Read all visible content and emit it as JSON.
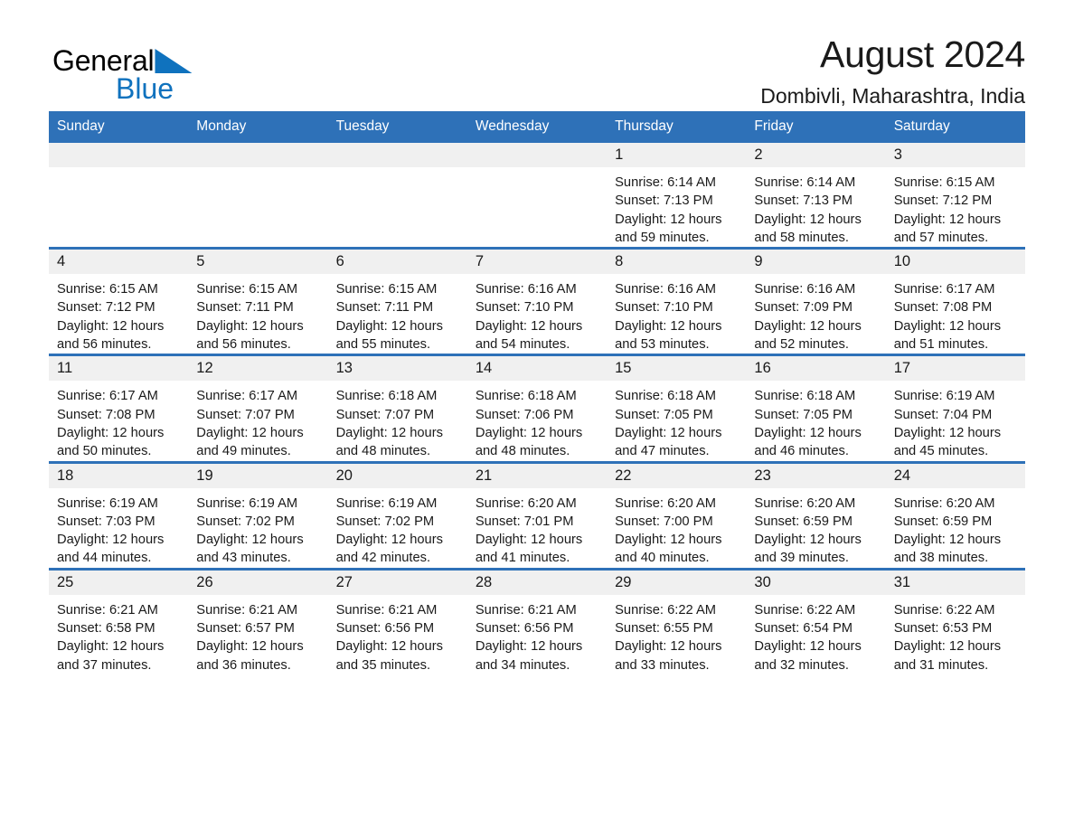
{
  "brand": {
    "name_part1": "General",
    "name_part2": "Blue",
    "triangle_color": "#0F72BE"
  },
  "header": {
    "title": "August 2024",
    "location": "Dombivli, Maharashtra, India"
  },
  "theme": {
    "header_blue": "#2E71B8",
    "daynum_gray": "#F0F0F0",
    "text_color": "#1a1a1a"
  },
  "weekday_headers": [
    "Sunday",
    "Monday",
    "Tuesday",
    "Wednesday",
    "Thursday",
    "Friday",
    "Saturday"
  ],
  "labels": {
    "sunrise_prefix": "Sunrise:",
    "sunset_prefix": "Sunset:",
    "daylight_prefix": "Daylight:"
  },
  "weeks": [
    [
      {
        "day": "",
        "empty": true,
        "line1": "",
        "line2": "",
        "line3": "",
        "line4": ""
      },
      {
        "day": "",
        "empty": true,
        "line1": "",
        "line2": "",
        "line3": "",
        "line4": ""
      },
      {
        "day": "",
        "empty": true,
        "line1": "",
        "line2": "",
        "line3": "",
        "line4": ""
      },
      {
        "day": "",
        "empty": true,
        "line1": "",
        "line2": "",
        "line3": "",
        "line4": ""
      },
      {
        "day": "1",
        "empty": false,
        "line1": "Sunrise: 6:14 AM",
        "line2": "Sunset: 7:13 PM",
        "line3": "Daylight: 12 hours",
        "line4": "and 59 minutes."
      },
      {
        "day": "2",
        "empty": false,
        "line1": "Sunrise: 6:14 AM",
        "line2": "Sunset: 7:13 PM",
        "line3": "Daylight: 12 hours",
        "line4": "and 58 minutes."
      },
      {
        "day": "3",
        "empty": false,
        "line1": "Sunrise: 6:15 AM",
        "line2": "Sunset: 7:12 PM",
        "line3": "Daylight: 12 hours",
        "line4": "and 57 minutes."
      }
    ],
    [
      {
        "day": "4",
        "empty": false,
        "line1": "Sunrise: 6:15 AM",
        "line2": "Sunset: 7:12 PM",
        "line3": "Daylight: 12 hours",
        "line4": "and 56 minutes."
      },
      {
        "day": "5",
        "empty": false,
        "line1": "Sunrise: 6:15 AM",
        "line2": "Sunset: 7:11 PM",
        "line3": "Daylight: 12 hours",
        "line4": "and 56 minutes."
      },
      {
        "day": "6",
        "empty": false,
        "line1": "Sunrise: 6:15 AM",
        "line2": "Sunset: 7:11 PM",
        "line3": "Daylight: 12 hours",
        "line4": "and 55 minutes."
      },
      {
        "day": "7",
        "empty": false,
        "line1": "Sunrise: 6:16 AM",
        "line2": "Sunset: 7:10 PM",
        "line3": "Daylight: 12 hours",
        "line4": "and 54 minutes."
      },
      {
        "day": "8",
        "empty": false,
        "line1": "Sunrise: 6:16 AM",
        "line2": "Sunset: 7:10 PM",
        "line3": "Daylight: 12 hours",
        "line4": "and 53 minutes."
      },
      {
        "day": "9",
        "empty": false,
        "line1": "Sunrise: 6:16 AM",
        "line2": "Sunset: 7:09 PM",
        "line3": "Daylight: 12 hours",
        "line4": "and 52 minutes."
      },
      {
        "day": "10",
        "empty": false,
        "line1": "Sunrise: 6:17 AM",
        "line2": "Sunset: 7:08 PM",
        "line3": "Daylight: 12 hours",
        "line4": "and 51 minutes."
      }
    ],
    [
      {
        "day": "11",
        "empty": false,
        "line1": "Sunrise: 6:17 AM",
        "line2": "Sunset: 7:08 PM",
        "line3": "Daylight: 12 hours",
        "line4": "and 50 minutes."
      },
      {
        "day": "12",
        "empty": false,
        "line1": "Sunrise: 6:17 AM",
        "line2": "Sunset: 7:07 PM",
        "line3": "Daylight: 12 hours",
        "line4": "and 49 minutes."
      },
      {
        "day": "13",
        "empty": false,
        "line1": "Sunrise: 6:18 AM",
        "line2": "Sunset: 7:07 PM",
        "line3": "Daylight: 12 hours",
        "line4": "and 48 minutes."
      },
      {
        "day": "14",
        "empty": false,
        "line1": "Sunrise: 6:18 AM",
        "line2": "Sunset: 7:06 PM",
        "line3": "Daylight: 12 hours",
        "line4": "and 48 minutes."
      },
      {
        "day": "15",
        "empty": false,
        "line1": "Sunrise: 6:18 AM",
        "line2": "Sunset: 7:05 PM",
        "line3": "Daylight: 12 hours",
        "line4": "and 47 minutes."
      },
      {
        "day": "16",
        "empty": false,
        "line1": "Sunrise: 6:18 AM",
        "line2": "Sunset: 7:05 PM",
        "line3": "Daylight: 12 hours",
        "line4": "and 46 minutes."
      },
      {
        "day": "17",
        "empty": false,
        "line1": "Sunrise: 6:19 AM",
        "line2": "Sunset: 7:04 PM",
        "line3": "Daylight: 12 hours",
        "line4": "and 45 minutes."
      }
    ],
    [
      {
        "day": "18",
        "empty": false,
        "line1": "Sunrise: 6:19 AM",
        "line2": "Sunset: 7:03 PM",
        "line3": "Daylight: 12 hours",
        "line4": "and 44 minutes."
      },
      {
        "day": "19",
        "empty": false,
        "line1": "Sunrise: 6:19 AM",
        "line2": "Sunset: 7:02 PM",
        "line3": "Daylight: 12 hours",
        "line4": "and 43 minutes."
      },
      {
        "day": "20",
        "empty": false,
        "line1": "Sunrise: 6:19 AM",
        "line2": "Sunset: 7:02 PM",
        "line3": "Daylight: 12 hours",
        "line4": "and 42 minutes."
      },
      {
        "day": "21",
        "empty": false,
        "line1": "Sunrise: 6:20 AM",
        "line2": "Sunset: 7:01 PM",
        "line3": "Daylight: 12 hours",
        "line4": "and 41 minutes."
      },
      {
        "day": "22",
        "empty": false,
        "line1": "Sunrise: 6:20 AM",
        "line2": "Sunset: 7:00 PM",
        "line3": "Daylight: 12 hours",
        "line4": "and 40 minutes."
      },
      {
        "day": "23",
        "empty": false,
        "line1": "Sunrise: 6:20 AM",
        "line2": "Sunset: 6:59 PM",
        "line3": "Daylight: 12 hours",
        "line4": "and 39 minutes."
      },
      {
        "day": "24",
        "empty": false,
        "line1": "Sunrise: 6:20 AM",
        "line2": "Sunset: 6:59 PM",
        "line3": "Daylight: 12 hours",
        "line4": "and 38 minutes."
      }
    ],
    [
      {
        "day": "25",
        "empty": false,
        "line1": "Sunrise: 6:21 AM",
        "line2": "Sunset: 6:58 PM",
        "line3": "Daylight: 12 hours",
        "line4": "and 37 minutes."
      },
      {
        "day": "26",
        "empty": false,
        "line1": "Sunrise: 6:21 AM",
        "line2": "Sunset: 6:57 PM",
        "line3": "Daylight: 12 hours",
        "line4": "and 36 minutes."
      },
      {
        "day": "27",
        "empty": false,
        "line1": "Sunrise: 6:21 AM",
        "line2": "Sunset: 6:56 PM",
        "line3": "Daylight: 12 hours",
        "line4": "and 35 minutes."
      },
      {
        "day": "28",
        "empty": false,
        "line1": "Sunrise: 6:21 AM",
        "line2": "Sunset: 6:56 PM",
        "line3": "Daylight: 12 hours",
        "line4": "and 34 minutes."
      },
      {
        "day": "29",
        "empty": false,
        "line1": "Sunrise: 6:22 AM",
        "line2": "Sunset: 6:55 PM",
        "line3": "Daylight: 12 hours",
        "line4": "and 33 minutes."
      },
      {
        "day": "30",
        "empty": false,
        "line1": "Sunrise: 6:22 AM",
        "line2": "Sunset: 6:54 PM",
        "line3": "Daylight: 12 hours",
        "line4": "and 32 minutes."
      },
      {
        "day": "31",
        "empty": false,
        "line1": "Sunrise: 6:22 AM",
        "line2": "Sunset: 6:53 PM",
        "line3": "Daylight: 12 hours",
        "line4": "and 31 minutes."
      }
    ]
  ]
}
